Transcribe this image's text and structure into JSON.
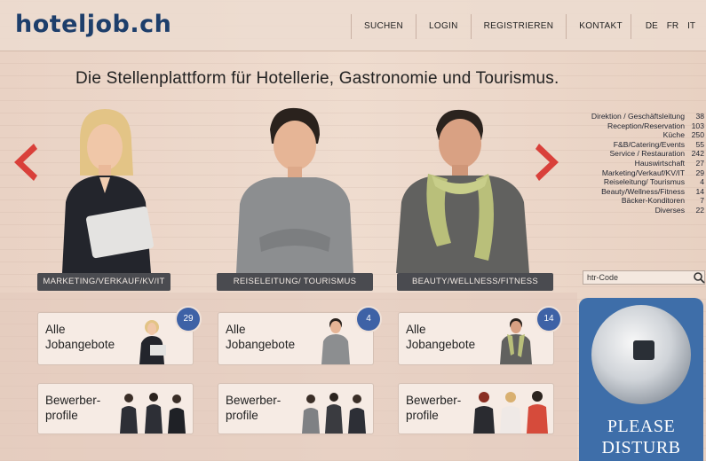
{
  "header": {
    "logo": "hoteljob.ch",
    "nav": [
      "SUCHEN",
      "LOGIN",
      "REGISTRIEREN",
      "KONTAKT"
    ],
    "languages": [
      "DE",
      "FR",
      "IT"
    ]
  },
  "headline": "Die Stellenplattform für Hotellerie, Gastronomie und Tourismus.",
  "hero": {
    "labels": [
      "MARKETING/VERKAUF/KV/IT",
      "REISELEITUNG/ TOURISMUS",
      "BEAUTY/WELLNESS/FITNESS"
    ]
  },
  "categories": [
    {
      "name": "Direktion / Geschäftsleitung",
      "count": "38"
    },
    {
      "name": "Reception/Reservation",
      "count": "103"
    },
    {
      "name": "Küche",
      "count": "250"
    },
    {
      "name": "F&B/Catering/Events",
      "count": "55"
    },
    {
      "name": "Service / Restauration",
      "count": "242"
    },
    {
      "name": "Hauswirtschaft",
      "count": "27"
    },
    {
      "name": "Marketing/Verkauf/KV/IT",
      "count": "29"
    },
    {
      "name": "Reiseleitung/ Tourismus",
      "count": "4"
    },
    {
      "name": "Beauty/Wellness/Fitness",
      "count": "14"
    },
    {
      "name": "Bäcker-Konditoren",
      "count": "7"
    },
    {
      "name": "Diverses",
      "count": "22"
    }
  ],
  "search": {
    "placeholder": "htr-Code"
  },
  "cards": {
    "jobs": [
      {
        "line1": "Alle",
        "line2": "Jobangebote",
        "badge": "29"
      },
      {
        "line1": "Alle",
        "line2": "Jobangebote",
        "badge": "4"
      },
      {
        "line1": "Alle",
        "line2": "Jobangebote",
        "badge": "14"
      }
    ],
    "profiles": [
      {
        "line1": "Bewerber-",
        "line2": "profile"
      },
      {
        "line1": "Bewerber-",
        "line2": "profile"
      },
      {
        "line1": "Bewerber-",
        "line2": "profile"
      }
    ]
  },
  "hanger": {
    "line1": "PLEASE",
    "line2": "DISTURB"
  },
  "colors": {
    "brand": "#1d3e6b",
    "accent_red": "#d9403a",
    "badge": "#3e62a6",
    "label_bar": "#4a4b50"
  }
}
